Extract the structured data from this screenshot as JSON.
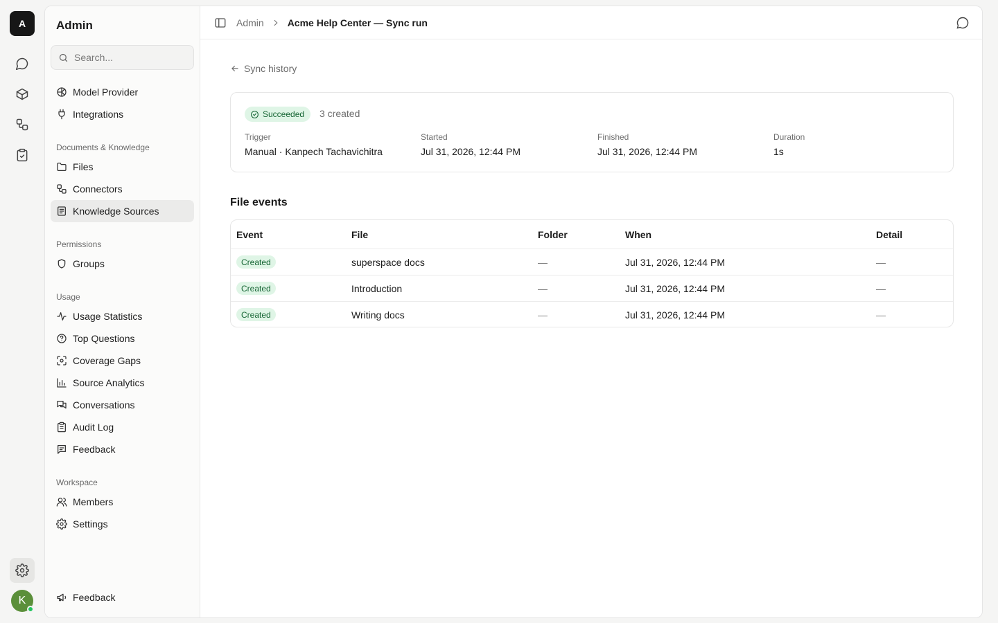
{
  "rail": {
    "logo": "A",
    "avatar": "K",
    "items": [
      {
        "name": "chat-icon"
      },
      {
        "name": "box-icon"
      },
      {
        "name": "workflow-icon"
      },
      {
        "name": "clipboard-check-icon"
      },
      {
        "name": "gear-icon"
      }
    ]
  },
  "sidebar": {
    "title": "Admin",
    "search_placeholder": "Search...",
    "top_items": [
      {
        "label": "Model Provider",
        "icon": "globe-icon"
      },
      {
        "label": "Integrations",
        "icon": "plug-icon"
      }
    ],
    "sections": [
      {
        "label": "Documents & Knowledge",
        "items": [
          {
            "label": "Files",
            "icon": "folder-icon"
          },
          {
            "label": "Connectors",
            "icon": "connector-icon"
          },
          {
            "label": "Knowledge Sources",
            "icon": "book-icon",
            "active": true
          }
        ]
      },
      {
        "label": "Permissions",
        "items": [
          {
            "label": "Groups",
            "icon": "shield-icon"
          }
        ]
      },
      {
        "label": "Usage",
        "items": [
          {
            "label": "Usage Statistics",
            "icon": "activity-icon"
          },
          {
            "label": "Top Questions",
            "icon": "help-circle-icon"
          },
          {
            "label": "Coverage Gaps",
            "icon": "scan-icon"
          },
          {
            "label": "Source Analytics",
            "icon": "bar-chart-icon"
          },
          {
            "label": "Conversations",
            "icon": "messages-icon"
          },
          {
            "label": "Audit Log",
            "icon": "clipboard-list-icon"
          },
          {
            "label": "Feedback",
            "icon": "message-square-text-icon"
          }
        ]
      },
      {
        "label": "Workspace",
        "items": [
          {
            "label": "Members",
            "icon": "users-icon"
          },
          {
            "label": "Settings",
            "icon": "gear-icon"
          }
        ]
      }
    ],
    "footer_item": {
      "label": "Feedback",
      "icon": "megaphone-icon"
    }
  },
  "topbar": {
    "crumb_root": "Admin",
    "crumb_current": "Acme Help Center — Sync run"
  },
  "back_link": "Sync history",
  "run": {
    "status": "Succeeded",
    "summary": "3 created",
    "trigger_label": "Trigger",
    "trigger_value": "Manual · Kanpech Tachavichitra",
    "started_label": "Started",
    "started_value": "Jul 31, 2026, 12:44 PM",
    "finished_label": "Finished",
    "finished_value": "Jul 31, 2026, 12:44 PM",
    "duration_label": "Duration",
    "duration_value": "1s",
    "status_color": "#166534"
  },
  "file_events": {
    "title": "File events",
    "columns": [
      "Event",
      "File",
      "Folder",
      "When",
      "Detail"
    ],
    "rows": [
      {
        "event": "Created",
        "file": "superspace docs",
        "folder": "—",
        "when": "Jul 31, 2026, 12:44 PM",
        "detail": "—"
      },
      {
        "event": "Created",
        "file": "Introduction",
        "folder": "—",
        "when": "Jul 31, 2026, 12:44 PM",
        "detail": "—"
      },
      {
        "event": "Created",
        "file": "Writing docs",
        "folder": "—",
        "when": "Jul 31, 2026, 12:44 PM",
        "detail": "—"
      }
    ]
  }
}
